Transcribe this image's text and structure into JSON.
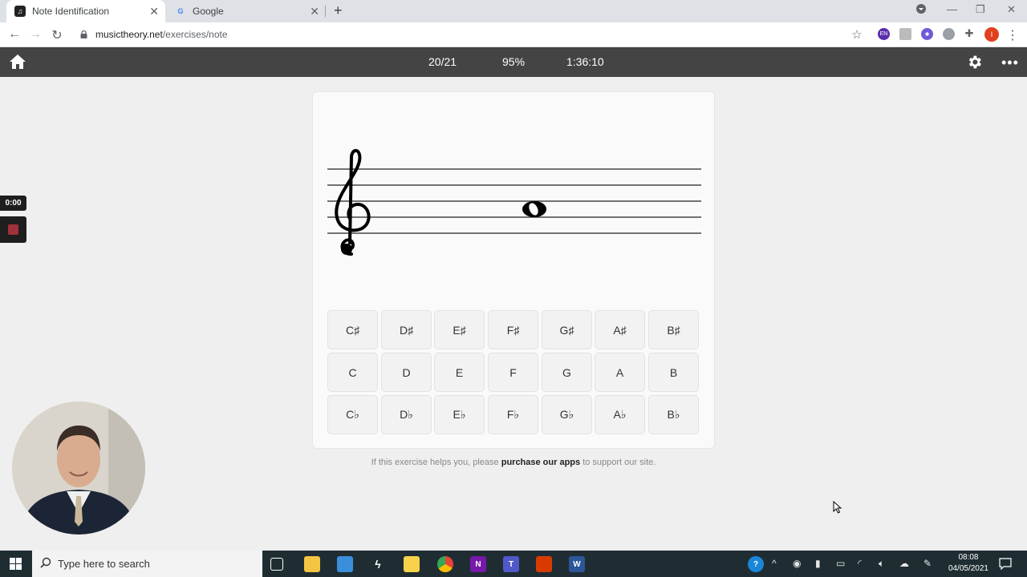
{
  "browser": {
    "tabs": [
      {
        "title": "Note Identification",
        "active": true
      },
      {
        "title": "Google",
        "active": false
      }
    ],
    "url": {
      "host": "musictheory.net",
      "path": "/exercises/note"
    }
  },
  "app": {
    "progress": "20/21",
    "accuracy": "95%",
    "time": "1:36:10"
  },
  "exercise": {
    "clef": "treble",
    "note_on_staff": "line-3-middle",
    "rows": [
      [
        "C♯",
        "D♯",
        "E♯",
        "F♯",
        "G♯",
        "A♯",
        "B♯"
      ],
      [
        "C",
        "D",
        "E",
        "F",
        "G",
        "A",
        "B"
      ],
      [
        "C♭",
        "D♭",
        "E♭",
        "F♭",
        "G♭",
        "A♭",
        "B♭"
      ]
    ]
  },
  "footer": {
    "prefix": "If this exercise helps you, please ",
    "link": "purchase our apps",
    "suffix": " to support our site."
  },
  "recorder": {
    "timer": "0:00"
  },
  "taskbar": {
    "search_placeholder": "Type here to search",
    "time": "08:08",
    "date": "04/05/2021"
  },
  "colors": {
    "appbar": "#444444",
    "recorder_stop": "#a0303a",
    "taskbar": "#1f2d33"
  }
}
